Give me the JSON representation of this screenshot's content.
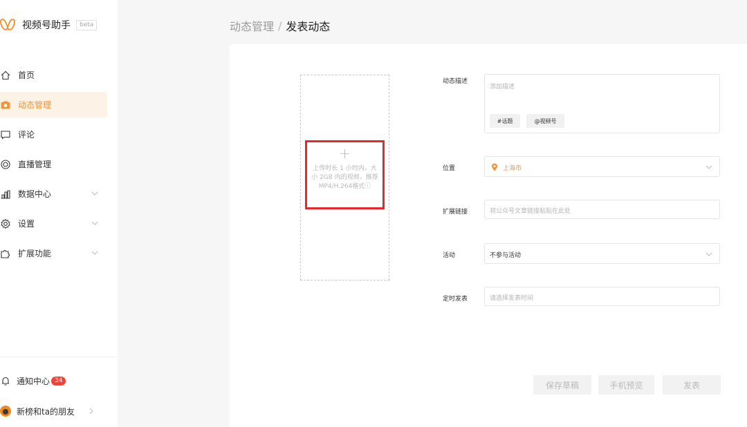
{
  "brand": {
    "name": "视频号助手",
    "badge": "beta",
    "accent": "#f1953a"
  },
  "nav": {
    "home": "首页",
    "posts": "动态管理",
    "comments": "评论",
    "live": "直播管理",
    "data": "数据中心",
    "settings": "设置",
    "extensions": "扩展功能"
  },
  "footer": {
    "notifications": "通知中心",
    "notifications_count": "34",
    "account": "新榜和ta的朋友"
  },
  "breadcrumb": {
    "parent": "动态管理",
    "separator": "/",
    "current": "发表动态"
  },
  "upload": {
    "plus": "+",
    "hint": "上传时长 1 小时内，大小 2GB 内的视频，推荐MP4/H.264格式ⓘ"
  },
  "form": {
    "description": {
      "label": "动态描述",
      "placeholder": "添加描述",
      "topic_tag": "#话题",
      "mention_tag": "@视频号"
    },
    "location": {
      "label": "位置",
      "value": "上海市"
    },
    "link": {
      "label": "扩展链接",
      "placeholder": "将公众号文章链接粘贴在此处"
    },
    "activity": {
      "label": "活动",
      "value": "不参与活动"
    },
    "schedule": {
      "label": "定时发表",
      "placeholder": "请选择发表时间"
    }
  },
  "actions": {
    "save_draft": "保存草稿",
    "preview": "手机预览",
    "publish": "发表"
  },
  "colors": {
    "active_bg": "#fdf2e6",
    "highlight_border": "#e8272a",
    "badge": "#f44336"
  }
}
